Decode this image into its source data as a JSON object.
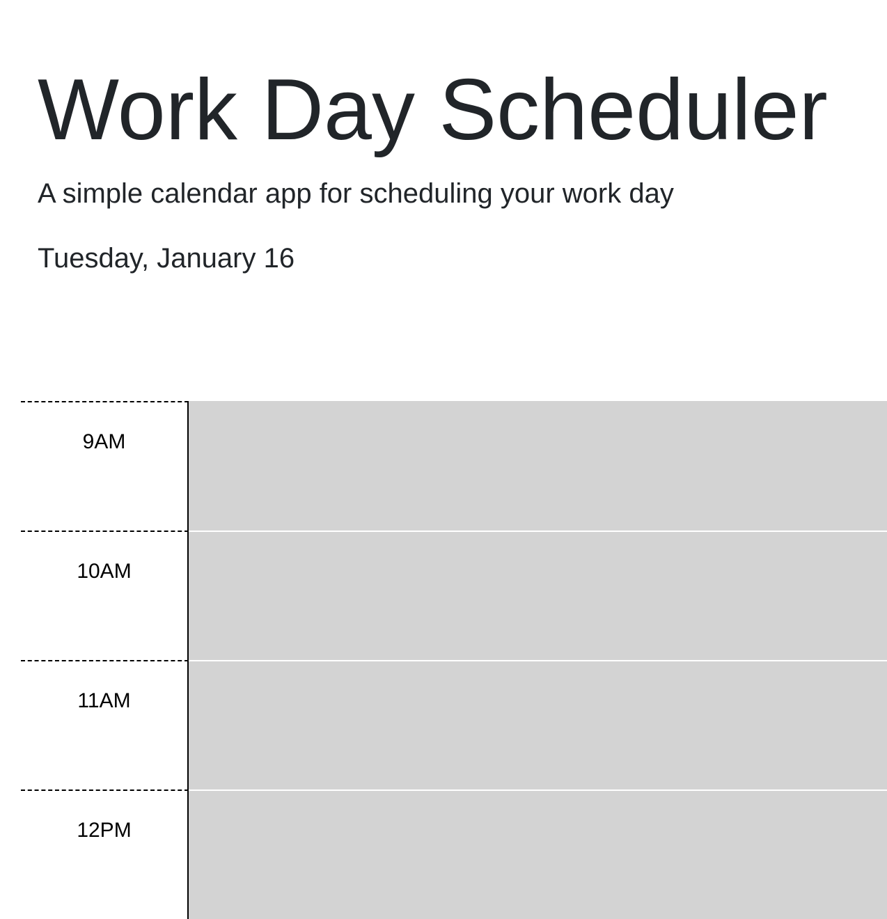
{
  "header": {
    "title": "Work Day Scheduler",
    "lead": "A simple calendar app for scheduling your work day",
    "current_day": "Tuesday, January 16"
  },
  "timeblocks": [
    {
      "hour": "9AM",
      "description": ""
    },
    {
      "hour": "10AM",
      "description": ""
    },
    {
      "hour": "11AM",
      "description": ""
    },
    {
      "hour": "12PM",
      "description": ""
    }
  ],
  "colors": {
    "past_block": "#d3d3d3",
    "text": "#212529",
    "border": "#000000"
  }
}
